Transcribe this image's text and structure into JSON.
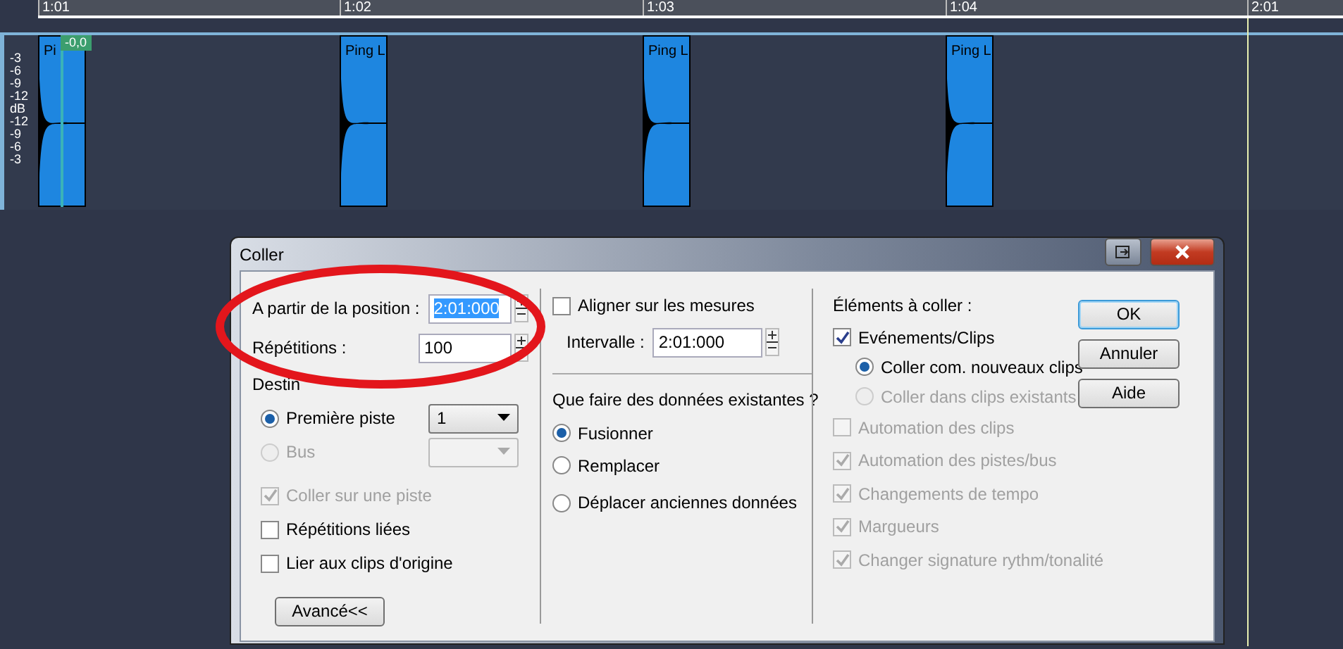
{
  "ruler": {
    "marks": [
      "1:01",
      "1:02",
      "1:03",
      "1:04",
      "2:01"
    ]
  },
  "track": {
    "db_scale": [
      "-3",
      "-6",
      "-9",
      "-12",
      "dB",
      "-12",
      "-9",
      "-6",
      "-3"
    ],
    "volume_tag": "-0,0",
    "clips": [
      {
        "label": "Pi"
      },
      {
        "label": "Ping L"
      },
      {
        "label": "Ping L"
      },
      {
        "label": "Ping L"
      }
    ]
  },
  "dialog": {
    "title": "Coller",
    "left": [
      {
        "kind": "field",
        "label": "A partir de la position :",
        "value": "2:01:000",
        "text_selected": true
      },
      {
        "kind": "field",
        "label": "Répétitions :",
        "value": "100",
        "text_selected": false
      },
      {
        "kind": "heading",
        "label": "Destin"
      },
      {
        "kind": "radio_select",
        "label": "Première piste",
        "selected": true,
        "disabled": false,
        "value": "1"
      },
      {
        "kind": "radio_select",
        "label": "Bus",
        "selected": false,
        "disabled": true
      },
      {
        "kind": "checkbox",
        "label": "Coller sur une piste",
        "checked": true,
        "disabled": true
      },
      {
        "kind": "checkbox",
        "label": "Répétitions liées",
        "checked": false,
        "disabled": false
      },
      {
        "kind": "checkbox",
        "label": "Lier aux clips d'origine",
        "checked": false,
        "disabled": false
      },
      {
        "kind": "button",
        "label": "Avancé<<"
      }
    ],
    "middle": [
      {
        "kind": "checkbox",
        "label": "Aligner sur les mesures",
        "checked": false,
        "disabled": false
      },
      {
        "kind": "field",
        "label": "Intervalle :",
        "value": "2:01:000",
        "text_selected": false
      },
      {
        "kind": "rule"
      },
      {
        "kind": "heading",
        "label": "Que faire des données existantes ?"
      },
      {
        "kind": "radio",
        "label": "Fusionner",
        "selected": true,
        "disabled": false
      },
      {
        "kind": "radio",
        "label": "Remplacer",
        "selected": false,
        "disabled": false
      },
      {
        "kind": "radio",
        "label": "Déplacer anciennes données",
        "selected": false,
        "disabled": false
      }
    ],
    "right": [
      {
        "kind": "heading",
        "label": "Éléments à coller :"
      },
      {
        "kind": "checkbox",
        "label": "Evénements/Clips",
        "checked": true,
        "disabled": false
      },
      {
        "kind": "radio",
        "label": "Coller com. nouveaux clips",
        "selected": true,
        "disabled": false,
        "indent": true
      },
      {
        "kind": "radio",
        "label": "Coller dans clips existants",
        "selected": false,
        "disabled": true,
        "indent": true
      },
      {
        "kind": "checkbox",
        "label": "Automation des clips",
        "checked": false,
        "disabled": true
      },
      {
        "kind": "checkbox",
        "label": "Automation des pistes/bus",
        "checked": true,
        "disabled": true
      },
      {
        "kind": "checkbox",
        "label": "Changements de tempo",
        "checked": true,
        "disabled": true
      },
      {
        "kind": "checkbox",
        "label": "Margueurs",
        "checked": true,
        "disabled": true
      },
      {
        "kind": "checkbox",
        "label": "Changer signature rythm/tonalité",
        "checked": true,
        "disabled": true
      }
    ],
    "buttons": [
      {
        "label": "OK",
        "focused": true
      },
      {
        "label": "Annuler",
        "focused": false
      },
      {
        "label": "Aide",
        "focused": false
      }
    ]
  },
  "annotation": {
    "kind": "ellipse"
  }
}
